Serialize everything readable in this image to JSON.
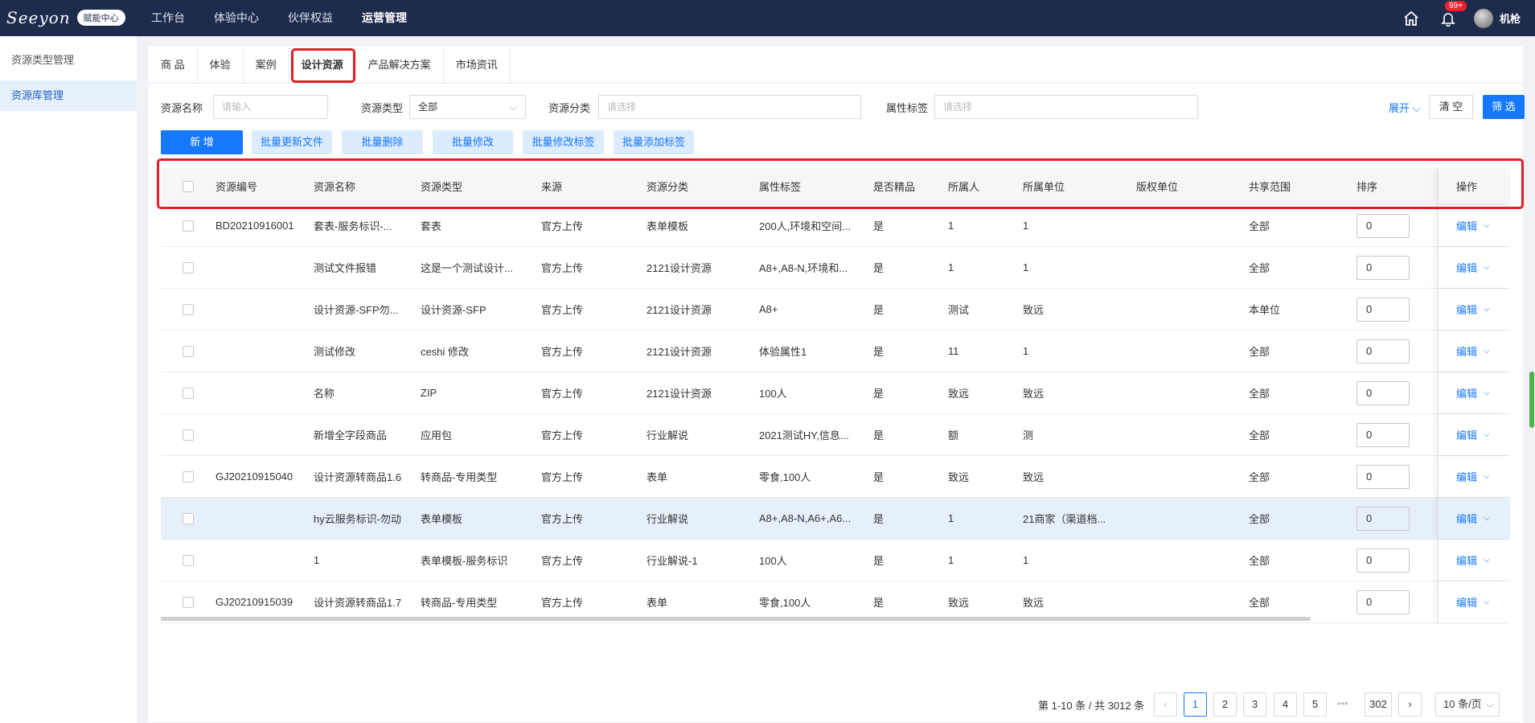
{
  "topbar": {
    "logo_text": "Seeyon",
    "logo_badge": "赋能中心",
    "nav": [
      "工作台",
      "体验中心",
      "伙伴权益",
      "运营管理"
    ],
    "active_nav": "运营管理",
    "badge": "99+",
    "user": "机枪"
  },
  "sidebar": {
    "items": [
      "资源类型管理",
      "资源库管理"
    ],
    "active": "资源库管理"
  },
  "tabs": {
    "items": [
      "商 品",
      "体验",
      "案例",
      "设计资源",
      "产品解决方案",
      "市场资讯"
    ],
    "active": "设计资源"
  },
  "filters": {
    "name_label": "资源名称",
    "name_placeholder": "请输入",
    "type_label": "资源类型",
    "type_value": "全部",
    "category_label": "资源分类",
    "category_placeholder": "请选择",
    "tag_label": "属性标签",
    "tag_placeholder": "请选择",
    "expand": "展开",
    "clear": "清 空",
    "filter": "筛 选"
  },
  "actions": {
    "new": "新 增",
    "batch_update": "批量更新文件",
    "batch_delete": "批量删除",
    "batch_edit": "批量修改",
    "batch_edit_tags": "批量修改标签",
    "batch_add_tags": "批量添加标签"
  },
  "table": {
    "headers": [
      "资源编号",
      "资源名称",
      "资源类型",
      "来源",
      "资源分类",
      "属性标签",
      "是否精品",
      "所属人",
      "所属单位",
      "版权单位",
      "共享范围",
      "排序",
      "操作"
    ],
    "edit_label": "编辑",
    "rows": [
      {
        "id": "BD20210916001",
        "name": "套表-服务标识-...",
        "type": "套表",
        "source": "官方上传",
        "category": "表单模板",
        "tags": "200人,环境和空间...",
        "premium": "是",
        "owner": "1",
        "unit": "1",
        "copyright": "",
        "share": "全部",
        "order": "0",
        "selected": false
      },
      {
        "id": "",
        "name": "测试文件报错",
        "type": "这是一个测试设计...",
        "source": "官方上传",
        "category": "2121设计资源",
        "tags": "A8+,A8-N,环境和...",
        "premium": "是",
        "owner": "1",
        "unit": "1",
        "copyright": "",
        "share": "全部",
        "order": "0",
        "selected": false
      },
      {
        "id": "",
        "name": "设计资源-SFP勿...",
        "type": "设计资源-SFP",
        "source": "官方上传",
        "category": "2121设计资源",
        "tags": "A8+",
        "premium": "是",
        "owner": "测试",
        "unit": "致远",
        "copyright": "",
        "share": "本单位",
        "order": "0",
        "selected": false
      },
      {
        "id": "",
        "name": "测试修改",
        "type": "ceshi 修改",
        "source": "官方上传",
        "category": "2121设计资源",
        "tags": "体验属性1",
        "premium": "是",
        "owner": "11",
        "unit": "1",
        "copyright": "",
        "share": "全部",
        "order": "0",
        "selected": false
      },
      {
        "id": "",
        "name": "名称",
        "type": "ZIP",
        "source": "官方上传",
        "category": "2121设计资源",
        "tags": "100人",
        "premium": "是",
        "owner": "致远",
        "unit": "致远",
        "copyright": "",
        "share": "全部",
        "order": "0",
        "selected": false
      },
      {
        "id": "",
        "name": "新增全字段商品",
        "type": "应用包",
        "source": "官方上传",
        "category": "行业解说",
        "tags": "2021测试HY,信息...",
        "premium": "是",
        "owner": "额",
        "unit": "测",
        "copyright": "",
        "share": "全部",
        "order": "0",
        "selected": false
      },
      {
        "id": "GJ20210915040",
        "name": "设计资源转商品1.6",
        "type": "转商品-专用类型",
        "source": "官方上传",
        "category": "表单",
        "tags": "零食,100人",
        "premium": "是",
        "owner": "致远",
        "unit": "致远",
        "copyright": "",
        "share": "全部",
        "order": "0",
        "selected": false
      },
      {
        "id": "",
        "name": "hy云服务标识-勿动",
        "type": "表单模板",
        "source": "官方上传",
        "category": "行业解说",
        "tags": "A8+,A8-N,A6+,A6...",
        "premium": "是",
        "owner": "1",
        "unit": "21商家（渠道档...",
        "copyright": "",
        "share": "全部",
        "order": "0",
        "selected": true
      },
      {
        "id": "",
        "name": "1",
        "type": "表单模板-服务标识",
        "source": "官方上传",
        "category": "行业解说-1",
        "tags": "100人",
        "premium": "是",
        "owner": "1",
        "unit": "1",
        "copyright": "",
        "share": "全部",
        "order": "0",
        "selected": false
      },
      {
        "id": "GJ20210915039",
        "name": "设计资源转商品1.7",
        "type": "转商品-专用类型",
        "source": "官方上传",
        "category": "表单",
        "tags": "零食,100人",
        "premium": "是",
        "owner": "致远",
        "unit": "致远",
        "copyright": "",
        "share": "全部",
        "order": "0",
        "selected": false
      }
    ]
  },
  "pagination": {
    "total": "第 1-10 条 / 共 3012 条",
    "pages": [
      "1",
      "2",
      "3",
      "4",
      "5"
    ],
    "last": "302",
    "ellipsis": "•••",
    "current": "1",
    "page_size": "10 条/页"
  },
  "icons": [
    "home-icon",
    "bell-icon",
    "chevron-down-icon",
    "chevron-left-icon",
    "chevron-right-icon"
  ],
  "colors": {
    "nav_bg": "#1f2b4d",
    "primary": "#1677ff",
    "highlight": "#e51c23",
    "selected_row": "#e6f0fb"
  }
}
